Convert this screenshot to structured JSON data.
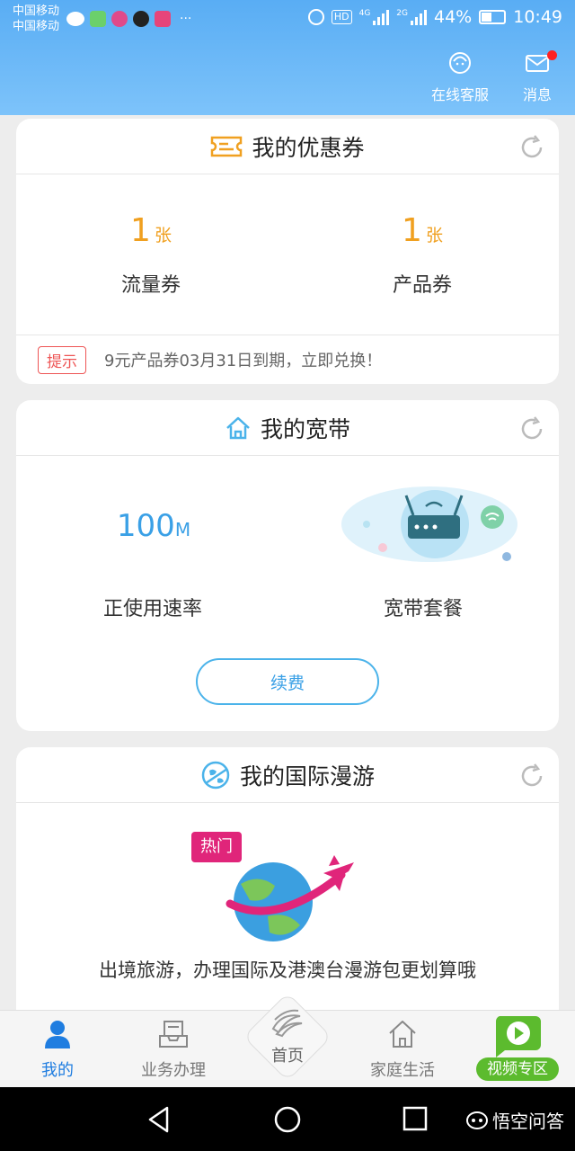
{
  "status_bar": {
    "carrier_1": "中国移动",
    "carrier_2": "中国移动",
    "more": "···",
    "hd": "HD",
    "net_1": "4G",
    "net_2": "2G",
    "battery": "44%",
    "time": "10:49"
  },
  "header": {
    "customer_service": "在线客服",
    "messages": "消息"
  },
  "coupons": {
    "title": "我的优惠券",
    "traffic_count": "1",
    "traffic_unit": "张",
    "traffic_label": "流量券",
    "product_count": "1",
    "product_unit": "张",
    "product_label": "产品券",
    "tip_badge": "提示",
    "tip_text": "9元产品券03月31日到期，立即兑换！"
  },
  "broadband": {
    "title": "我的宽带",
    "speed_value": "100",
    "speed_unit": "M",
    "speed_label": "正使用速率",
    "package_label": "宽带套餐",
    "renew_button": "续费"
  },
  "roaming": {
    "title": "我的国际漫游",
    "hot_badge": "热门",
    "description": "出境旅游，办理国际及港澳台漫游包更划算哦"
  },
  "tabbar": {
    "mine": "我的",
    "business": "业务办理",
    "home": "首页",
    "family": "家庭生活",
    "video": "视频专区"
  },
  "watermark": "悟空问答",
  "colors": {
    "header_blue": "#59adf4",
    "coupon_orange": "#f0a020",
    "accent_blue": "#3aa0e6",
    "tip_red": "#e55555",
    "video_green": "#5cbb2e"
  }
}
